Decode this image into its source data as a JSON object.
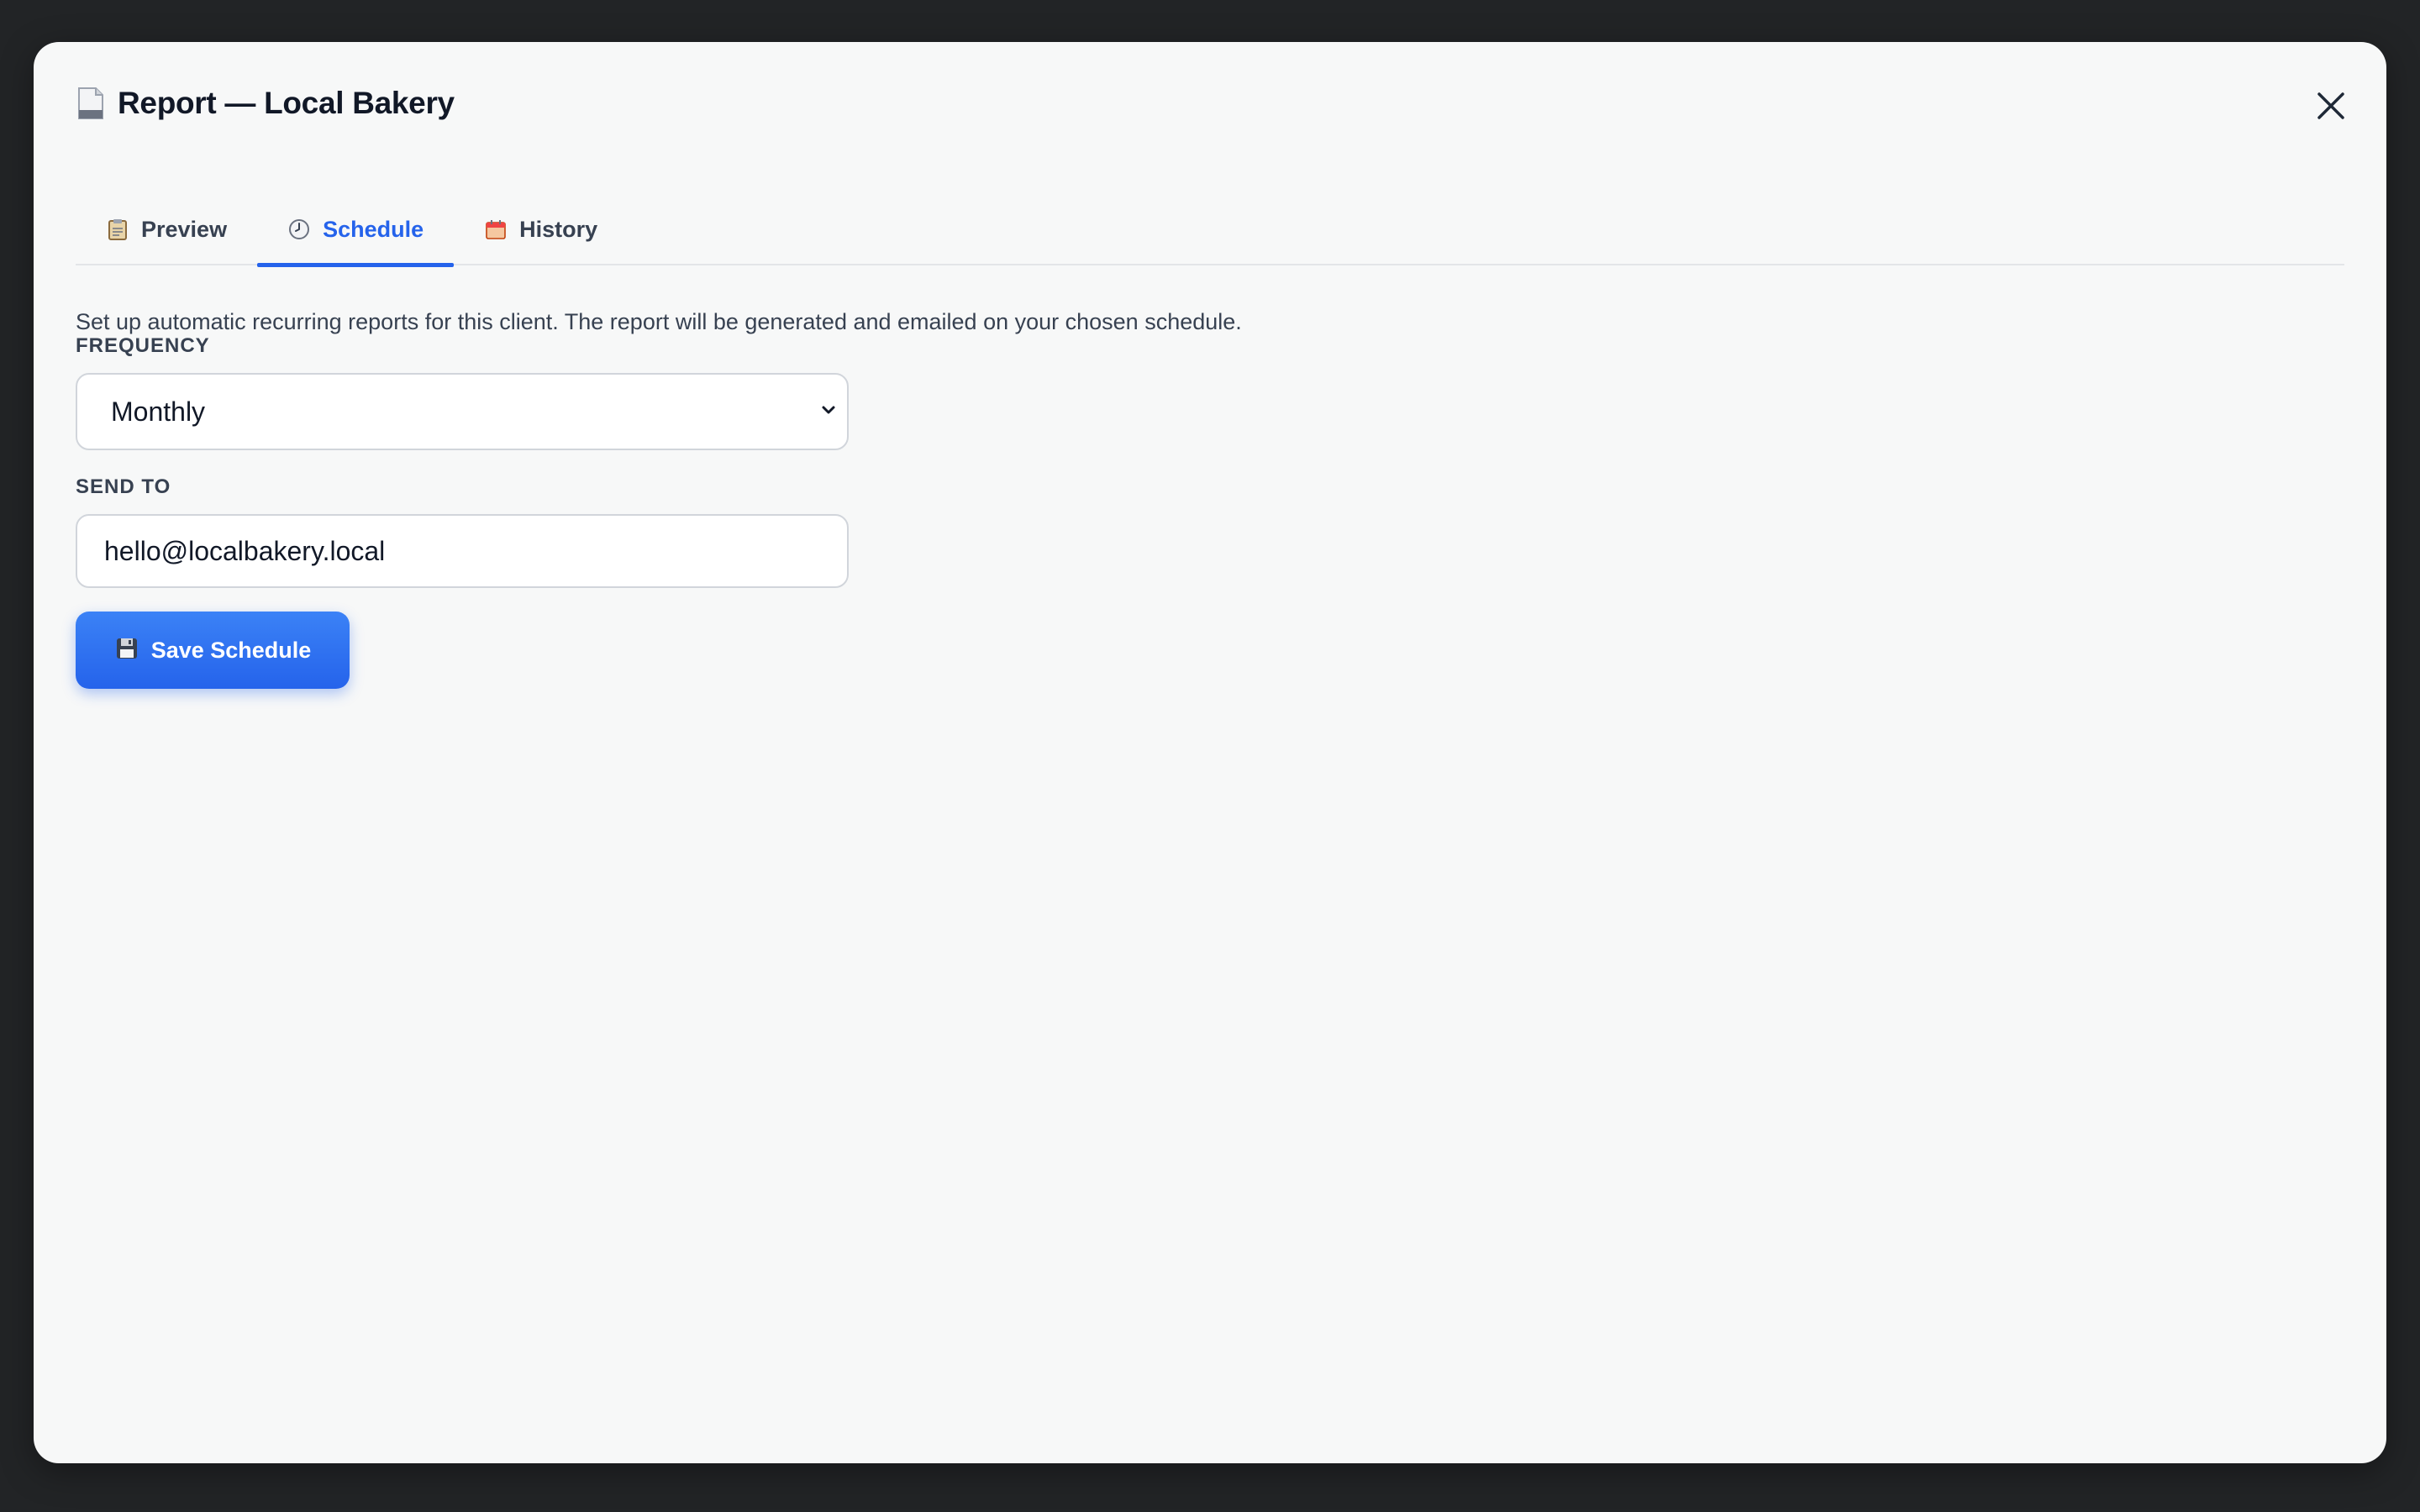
{
  "modal": {
    "title": "Report — Local Bakery",
    "title_icon": "document-icon",
    "close_icon": "close-icon"
  },
  "tabs": [
    {
      "label": "Preview",
      "icon": "clipboard-icon",
      "active": false
    },
    {
      "label": "Schedule",
      "icon": "clock-icon",
      "active": true
    },
    {
      "label": "History",
      "icon": "calendar-icon",
      "active": false
    }
  ],
  "schedule": {
    "description": "Set up automatic recurring reports for this client. The report will be generated and emailed on your chosen schedule.",
    "frequency_label": "FREQUENCY",
    "frequency_value": "Monthly",
    "send_to_label": "SEND TO",
    "send_to_value": "hello@localbakery.local",
    "save_label": "Save Schedule",
    "save_icon": "floppy-disk-icon"
  },
  "colors": {
    "accent": "#2563eb",
    "background": "#222426",
    "panel": "#f7f8f8"
  }
}
